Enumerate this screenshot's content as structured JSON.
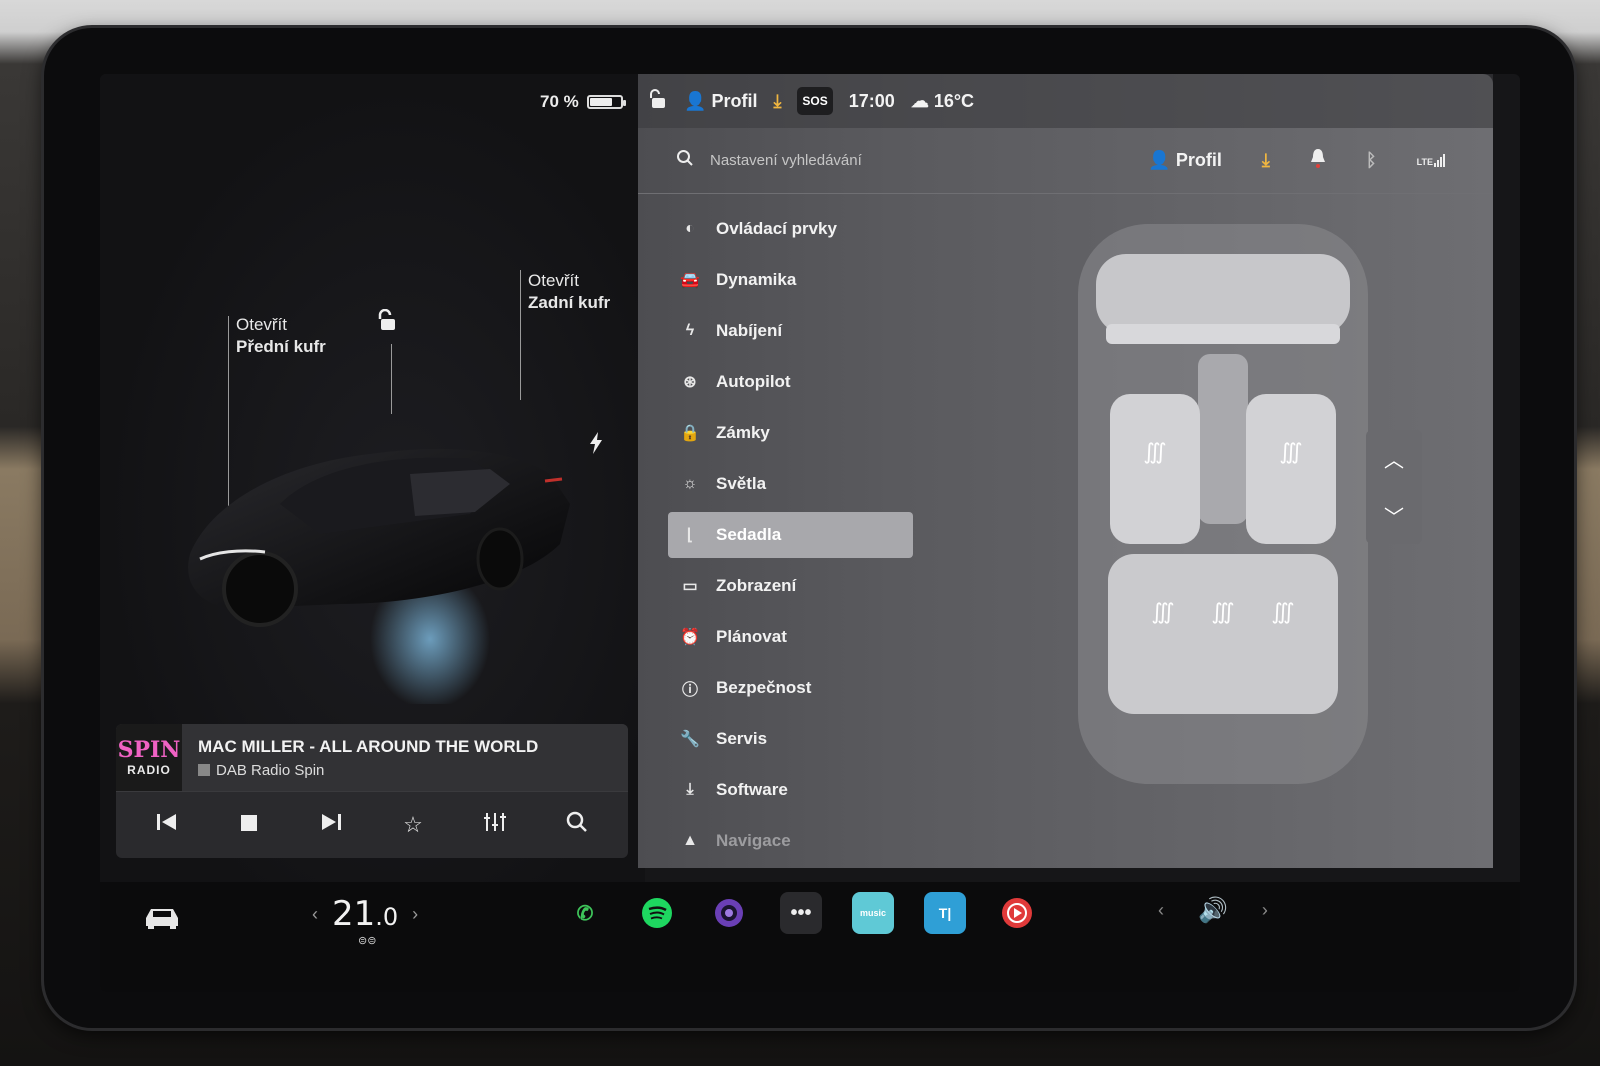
{
  "left": {
    "battery": "70 %",
    "front_trunk": {
      "line1": "Otevřít",
      "line2": "Přední kufr"
    },
    "rear_trunk": {
      "line1": "Otevřít",
      "line2": "Zadní kufr"
    }
  },
  "media": {
    "logo_line1": "SPIN",
    "logo_line2": "RADIO",
    "title": "MAC MILLER - ALL AROUND THE WORLD",
    "source": "DAB Radio Spin"
  },
  "status": {
    "profile": "Profil",
    "sos": "SOS",
    "time": "17:00",
    "temperature": "16°C"
  },
  "search": {
    "placeholder": "Nastavení vyhledávání",
    "profile": "Profil"
  },
  "menu": {
    "items": [
      {
        "label": "Ovládací prvky",
        "icon": "toggle-icon"
      },
      {
        "label": "Dynamika",
        "icon": "car-icon"
      },
      {
        "label": "Nabíjení",
        "icon": "bolt-icon"
      },
      {
        "label": "Autopilot",
        "icon": "steering-wheel-icon"
      },
      {
        "label": "Zámky",
        "icon": "lock-icon"
      },
      {
        "label": "Světla",
        "icon": "sun-icon"
      },
      {
        "label": "Sedadla",
        "icon": "seat-icon",
        "active": true
      },
      {
        "label": "Zobrazení",
        "icon": "display-icon"
      },
      {
        "label": "Plánovat",
        "icon": "alarm-icon"
      },
      {
        "label": "Bezpečnost",
        "icon": "alert-icon"
      },
      {
        "label": "Servis",
        "icon": "wrench-icon"
      },
      {
        "label": "Software",
        "icon": "download-icon"
      },
      {
        "label": "Navigace",
        "icon": "navigation-icon"
      }
    ]
  },
  "dock": {
    "temp_whole": "21",
    "temp_decimal": ".0",
    "apps": [
      "phone-icon",
      "spotify-icon",
      "camera-icon",
      "more-icon",
      "amazon-music-icon",
      "tidal-icon",
      "media-player-icon"
    ],
    "amazon_label": "music"
  }
}
